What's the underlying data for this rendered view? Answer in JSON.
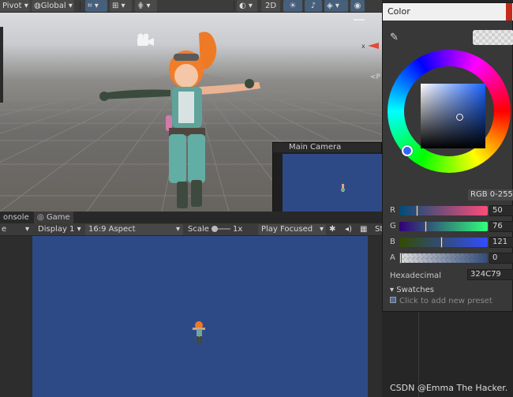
{
  "toolbar": {
    "pivot": "Pivot",
    "global": "Global",
    "mode_2d": "2D"
  },
  "scene": {
    "main_camera_title": "Main Camera",
    "axis_x": "x",
    "persp": "<P"
  },
  "tabs": [
    {
      "label": "onsole"
    },
    {
      "label": "Game"
    }
  ],
  "gamebar": {
    "display": "Display 1",
    "aspect": "16:9 Aspect",
    "scale_label": "Scale",
    "scale_value": "1x",
    "play_mode": "Play Focused",
    "stats_stub": "St"
  },
  "color_window": {
    "title": "Color",
    "mode": "RGB 0-255",
    "channels": [
      {
        "label": "R",
        "value": "50",
        "fraction": 0.196,
        "gradient": "linear-gradient(to right,#004c79,#ff4c79)"
      },
      {
        "label": "G",
        "value": "76",
        "fraction": 0.298,
        "gradient": "linear-gradient(to right,#320079,#32ff79)"
      },
      {
        "label": "B",
        "value": "121",
        "fraction": 0.475,
        "gradient": "linear-gradient(to right,#324c00,#324cff)"
      },
      {
        "label": "A",
        "value": "0",
        "fraction": 0.0,
        "gradient": "linear-gradient(to right,rgba(50,76,121,0),rgba(50,76,121,1))"
      }
    ],
    "hex_label": "Hexadecimal",
    "hex_value": "324C79",
    "swatches_label": "Swatches",
    "swatches_hint": "Click to add new preset",
    "color": "#324C79"
  },
  "watermark": "CSDN @Emma The Hacker."
}
